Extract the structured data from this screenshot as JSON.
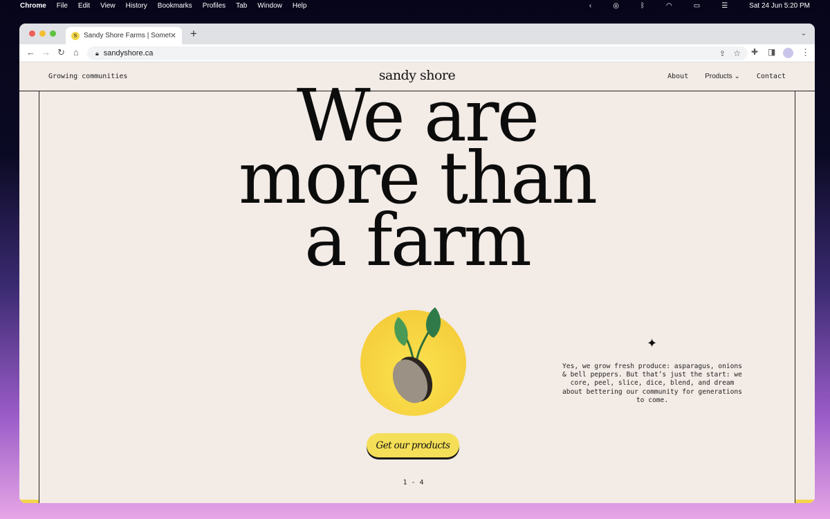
{
  "menubar": {
    "app": "Chrome",
    "items": [
      "File",
      "Edit",
      "View",
      "History",
      "Bookmarks",
      "Profiles",
      "Tab",
      "Window",
      "Help"
    ],
    "clock": "Sat 24 Jun  5:20 PM"
  },
  "browser": {
    "tab_title": "Sandy Shore Farms | Something",
    "favicon_letter": "S",
    "url": "sandyshore.ca"
  },
  "site": {
    "tagline": "Growing communities",
    "logo": "sandy shore",
    "nav": [
      {
        "label": "About"
      },
      {
        "label": "Products ⌄"
      },
      {
        "label": "Contact"
      }
    ]
  },
  "hero": {
    "lines": [
      "We are",
      "more than",
      "a farm"
    ],
    "cta": "Get our products",
    "pager": "1 - 4",
    "description": "Yes, we grow fresh produce: asparagus, onions & bell peppers. But that’s just the start: we core, peel, slice, dice, blend, and dream about bettering our community for generations to come."
  },
  "colors": {
    "page_bg": "#f3ebe6",
    "accent_yellow": "#f5df58",
    "leaf_green": "#2f8a4e"
  }
}
